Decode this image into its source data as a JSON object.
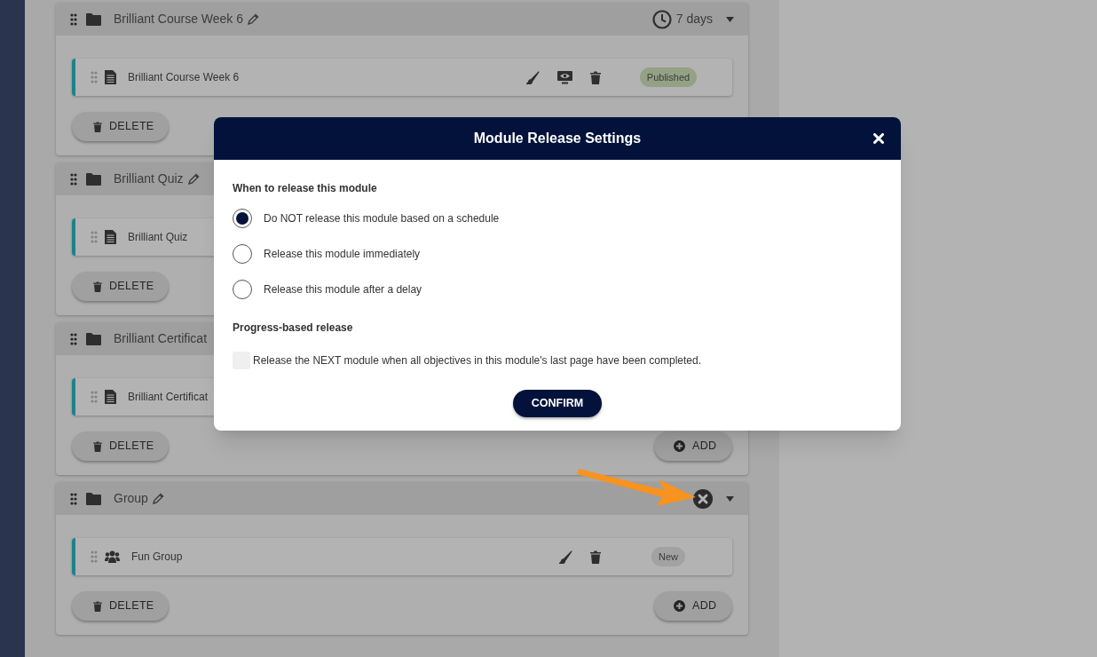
{
  "modules": [
    {
      "title": "Brilliant Course Week 6",
      "editable": true,
      "release": {
        "kind": "delay",
        "label": "7 days"
      },
      "items": [
        {
          "kind": "page",
          "title": "Brilliant Course Week 6",
          "actions": [
            {
              "kind": "brush"
            },
            {
              "kind": "preview"
            },
            {
              "kind": "trash"
            }
          ],
          "status": {
            "label": "Published",
            "color": "#94a184"
          }
        }
      ],
      "buttons": [
        {
          "kind": "delete",
          "label": "DELETE"
        }
      ]
    },
    {
      "title": "Brilliant Quiz",
      "editable": true,
      "items": [
        {
          "kind": "page",
          "title": "Brilliant Quiz"
        }
      ],
      "buttons": [
        {
          "kind": "delete",
          "label": "DELETE"
        }
      ]
    },
    {
      "title": "Brilliant Certificat",
      "editable": false,
      "items": [
        {
          "kind": "page",
          "title": "Brilliant Certificat"
        }
      ],
      "buttons": [
        {
          "kind": "delete",
          "label": "DELETE"
        },
        {
          "kind": "add",
          "label": "ADD"
        }
      ]
    },
    {
      "title": "Group",
      "editable": true,
      "release": {
        "kind": "none"
      },
      "items": [
        {
          "kind": "group",
          "title": "Fun Group",
          "actions": [
            {
              "kind": "brush"
            },
            {
              "kind": "trash"
            }
          ],
          "status": {
            "label": "New",
            "color": "#a2a2a2"
          }
        }
      ],
      "buttons": [
        {
          "kind": "delete",
          "label": "DELETE"
        },
        {
          "kind": "add",
          "label": "ADD"
        }
      ]
    }
  ],
  "dialog": {
    "title": "Module Release Settings",
    "schedule_heading": "When to release this module",
    "options": [
      {
        "label": "Do NOT release this module based on a schedule",
        "selected": true
      },
      {
        "label": "Release this module immediately",
        "selected": false
      },
      {
        "label": "Release this module after a delay",
        "selected": false
      }
    ],
    "progress_heading": "Progress-based release",
    "progress_option": {
      "label": "Release the NEXT module when all objectives in this module's last page have been completed.",
      "checked": false
    },
    "confirm": "CONFIRM"
  }
}
